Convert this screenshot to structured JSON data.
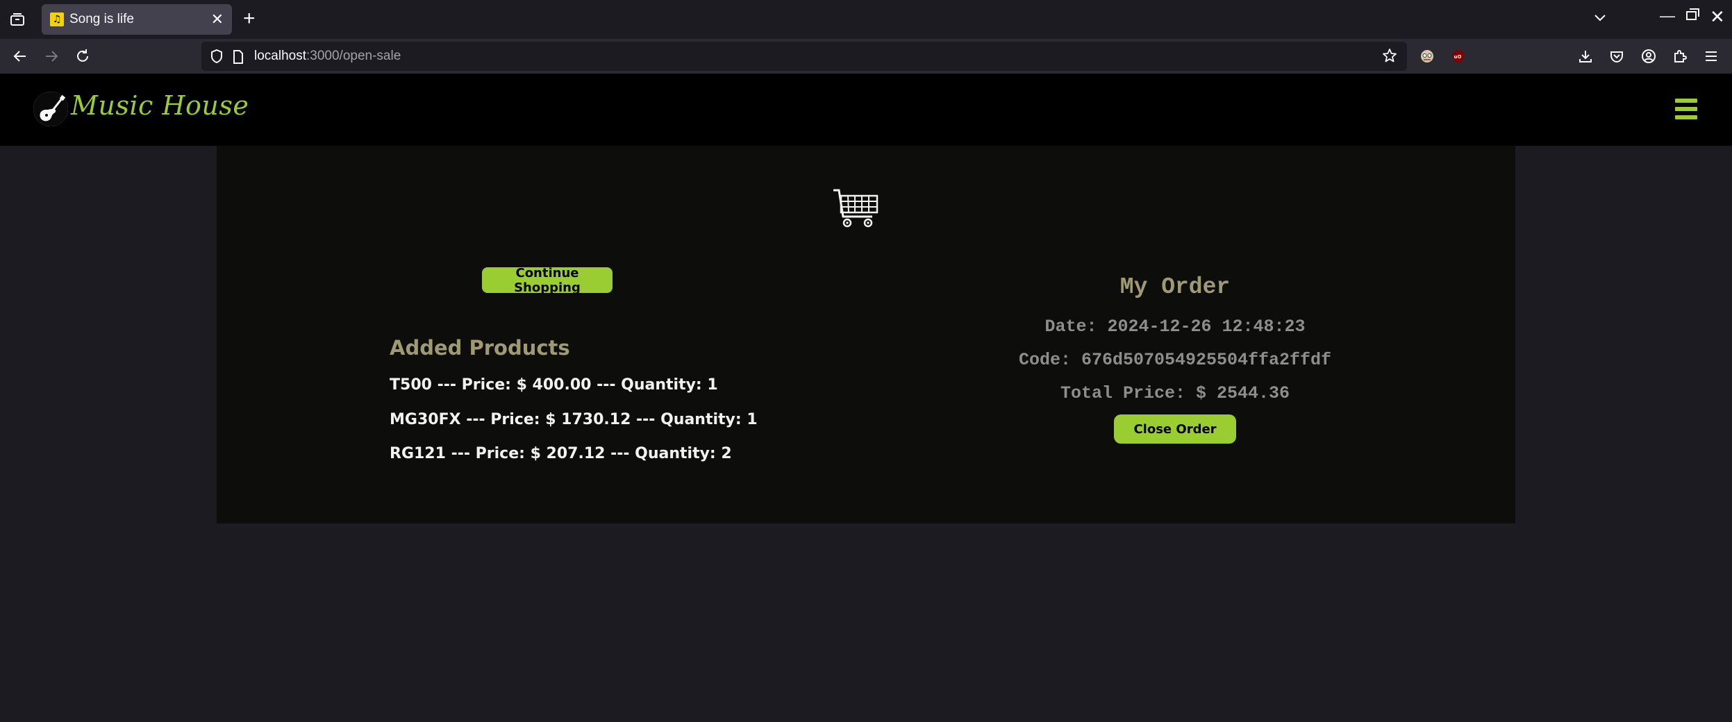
{
  "browser": {
    "tab_title": "Song is life",
    "url_host": "localhost",
    "url_path": ":3000/open-sale",
    "tab_favicon_glyph": "♫"
  },
  "site": {
    "brand": "Music House",
    "accent_color": "#9acd32"
  },
  "cart": {
    "continue_label": "Continue Shopping",
    "added_title": "Added Products",
    "products": [
      {
        "text": "T500 --- Price: $ 400.00 --- Quantity: 1"
      },
      {
        "text": "MG30FX --- Price: $ 1730.12 --- Quantity: 1"
      },
      {
        "text": "RG121 --- Price: $ 207.12 --- Quantity: 2"
      }
    ]
  },
  "order": {
    "title": "My Order",
    "date": "Date: 2024-12-26 12:48:23",
    "code": "Code: 676d507054925504ffa2ffdf",
    "total": "Total Price: $ 2544.36",
    "close_label": "Close Order"
  }
}
